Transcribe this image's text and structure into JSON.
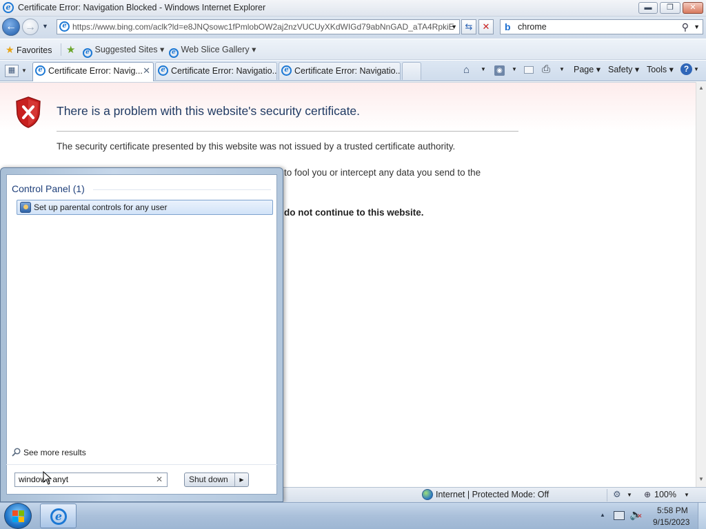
{
  "window": {
    "title": "Certificate Error: Navigation Blocked - Windows Internet Explorer",
    "min_glyph": "▬",
    "max_glyph": "❐",
    "close_glyph": "✕"
  },
  "address": {
    "url": "https://www.bing.com/aclk?ld=e8JNQsowc1fPmlobOW2aj2nzVUCUyXKdWIGd79abNnGAD_aTA4RpkiE",
    "dropdown": "▼",
    "refresh_glyph": "⇆",
    "stop_glyph": "✕"
  },
  "search": {
    "value": "chrome",
    "provider_glyph": "b",
    "search_glyph": "⚲",
    "dropdown": "▼"
  },
  "favorites_bar": {
    "favorites_label": "Favorites",
    "suggested_sites_label": "Suggested Sites",
    "web_slice_label": "Web Slice Gallery",
    "dropdown": "▾"
  },
  "tabs": [
    {
      "label": "Certificate Error: Navig...",
      "active": true
    },
    {
      "label": "Certificate Error: Navigatio...",
      "active": false
    },
    {
      "label": "Certificate Error: Navigatio...",
      "active": false
    }
  ],
  "command_bar": {
    "page_label": "Page",
    "safety_label": "Safety",
    "tools_label": "Tools",
    "dropdown": "▾"
  },
  "error_page": {
    "title": "There is a problem with this website's security certificate.",
    "line1": "The security certificate presented by this website was not issued by a trusted certificate authority.",
    "line2_partial": "to fool you or intercept any data you send to the",
    "line3_partial": "do not continue to this website."
  },
  "status_bar": {
    "zone_label": "Internet | Protected Mode: Off",
    "zoom": "100%",
    "dropdown": "▾"
  },
  "start_menu": {
    "group_heading": "Control Panel (1)",
    "result_item": "Set up parental controls for any user",
    "see_more_label": "See more results",
    "search_value": "windows anyt",
    "clear_glyph": "✕",
    "shutdown_label": "Shut down",
    "shutdown_arrow": "▶"
  },
  "taskbar": {
    "time": "5:58 PM",
    "date": "9/15/2023",
    "tray_arrow": "▲"
  },
  "colors": {
    "accent": "#1c78d4",
    "error_red": "#c8201f",
    "title_blue": "#1f3a63",
    "taskbar_blue": "#aac0da"
  }
}
